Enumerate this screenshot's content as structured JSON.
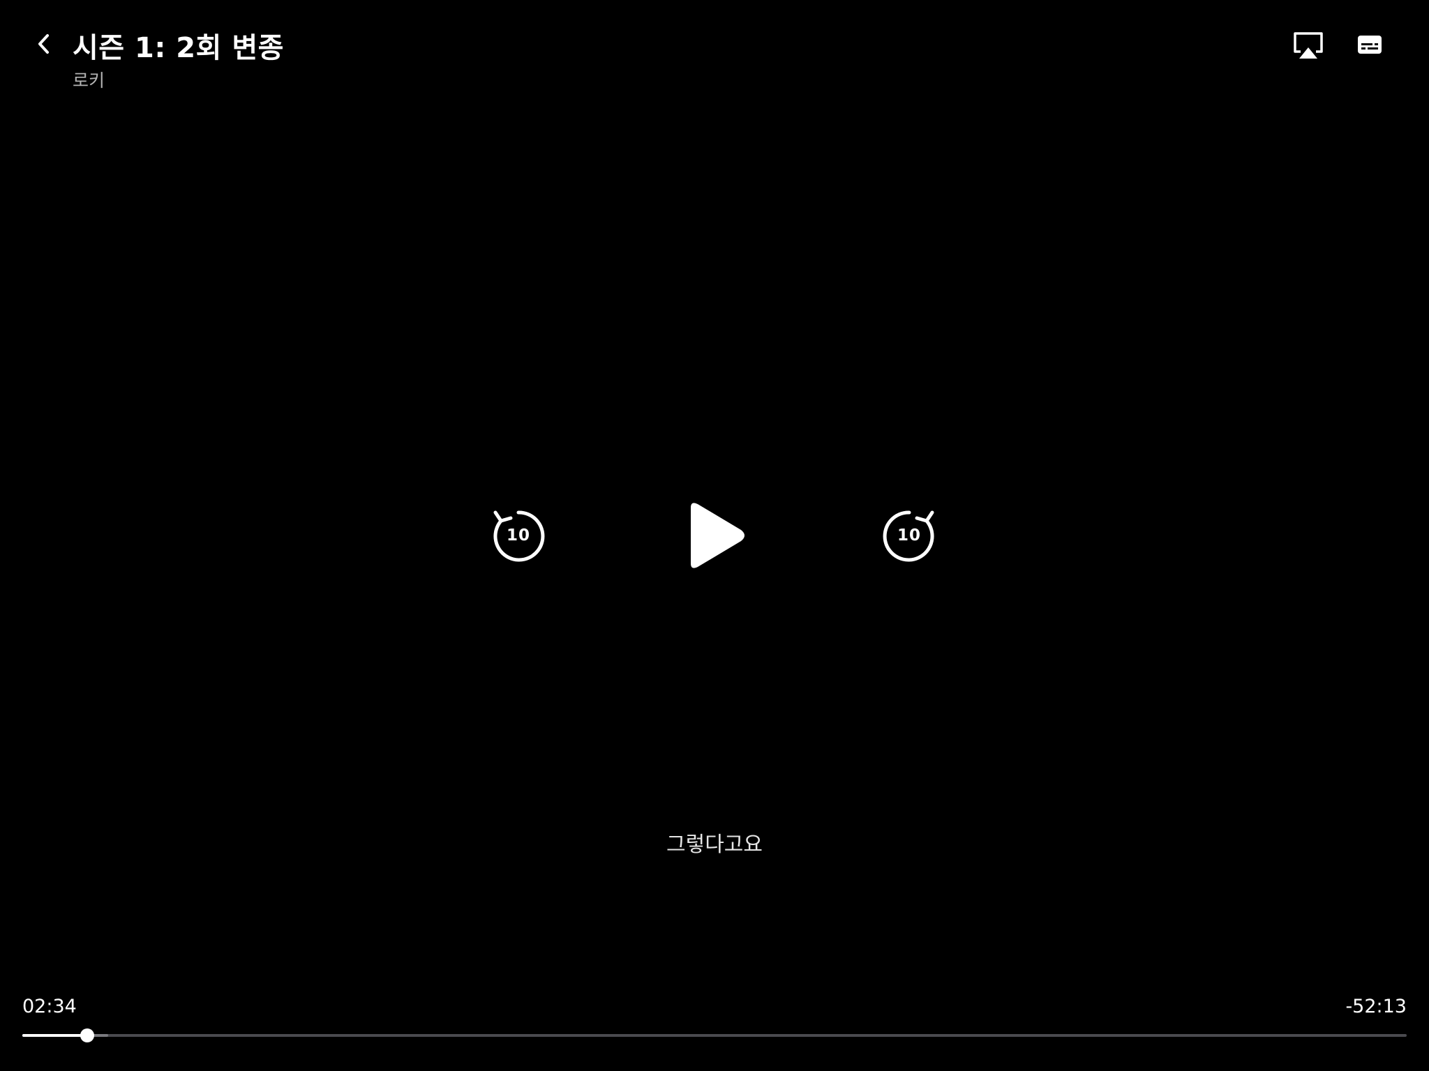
{
  "header": {
    "title": "시즌 1: 2회 변종",
    "show_name": "로키",
    "back_icon": "chevron-left-icon",
    "airplay_icon": "airplay-icon",
    "captions_icon": "subtitles-icon"
  },
  "controls": {
    "skip_back_label": "10",
    "skip_forward_label": "10",
    "play_icon": "play-icon"
  },
  "caption": {
    "text": "그렇다고요"
  },
  "progress": {
    "elapsed": "02:34",
    "remaining": "-52:13",
    "fraction": 0.0468,
    "buffered_fraction": 0.062
  },
  "colors": {
    "background": "#000000",
    "foreground": "#ffffff",
    "track": "#4a4a4f",
    "secondary_text": "#b3b3b3"
  }
}
